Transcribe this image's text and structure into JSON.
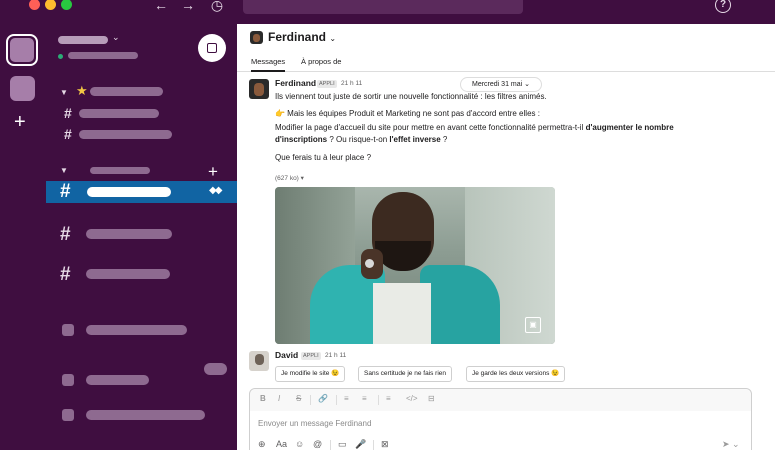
{
  "topbar": {
    "back_icon": "←",
    "forward_icon": "→",
    "history_icon": "◷",
    "help_icon": "?"
  },
  "sidebar": {
    "workspace_caret": "⌄",
    "add_workspace": "+",
    "add_channel": "+",
    "hash": "#",
    "star": "★",
    "active_indicator": "◆◆"
  },
  "channel": {
    "name": "Ferdinand",
    "caret": "⌄",
    "tabs": [
      {
        "label": "Messages",
        "active": true
      },
      {
        "label": "À propos de",
        "active": false
      }
    ],
    "date_divider": "Mercredi 31 mai  ⌄"
  },
  "messages": [
    {
      "sender": "Ferdinand",
      "tag": "APPLI",
      "time": "21 h 11",
      "line1": "Ils viennent tout juste de sortir une nouvelle fonctionnalité : les filtres animés.",
      "line2": "👉  Mais les équipes Produit et Marketing ne sont pas d'accord entre elles :",
      "line3_pre": "Modifier la page d'accueil du site pour mettre en avant cette fonctionnalité permettra-t-il ",
      "line3_bold": "d'augmenter le nombre",
      "line4_bold1": "d'inscriptions",
      "line4_mid": " ? Ou risque-t-on ",
      "line4_bold2": "l'effet inverse",
      "line4_end": " ?",
      "line5": "Que ferais tu à leur place ?",
      "file_size": "(627 ko) ▾",
      "gif_logo": "▣"
    },
    {
      "sender": "David",
      "tag": "APPLI",
      "time": "21 h 11",
      "buttons": [
        "Je modifie le site 😉",
        "Sans certitude je ne fais rien",
        "Je garde les deux versions 😉"
      ]
    }
  ],
  "composer": {
    "placeholder": "Envoyer un message Ferdinand",
    "format_tools": [
      "B",
      "I",
      "S",
      "🔗",
      "≡",
      "≡",
      "≡",
      "</>",
      "⊟"
    ],
    "bottom_tools": [
      "⊕",
      "Aa",
      "☺",
      "@",
      "▭",
      "🎤",
      "⊠"
    ],
    "send_icon": "➤  ⌄"
  },
  "colors": {
    "sidebar_bg": "#3f0e40",
    "active_channel": "#1164a3",
    "presence": "#2bac76"
  }
}
